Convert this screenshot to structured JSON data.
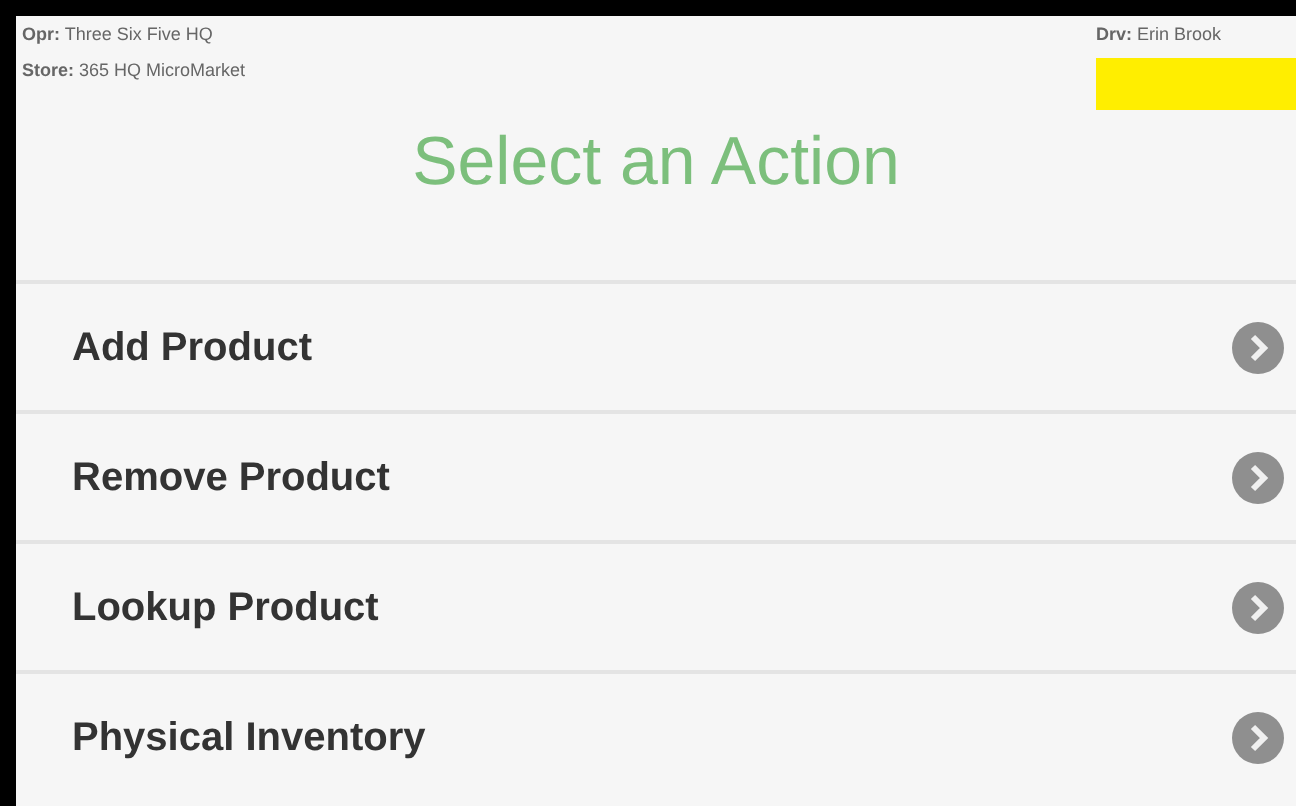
{
  "header": {
    "operator": "**Opr:** Three Six Five HQ",
    "store": "**Store:** 365 HQ MicroMarket",
    "driver": "**Drv:** Erin Brook"
  },
  "title": "Select an Action",
  "actions": [
    {
      "label": "Add Product"
    },
    {
      "label": "Remove Product"
    },
    {
      "label": "Lookup Product"
    },
    {
      "label": "Physical Inventory"
    }
  ]
}
